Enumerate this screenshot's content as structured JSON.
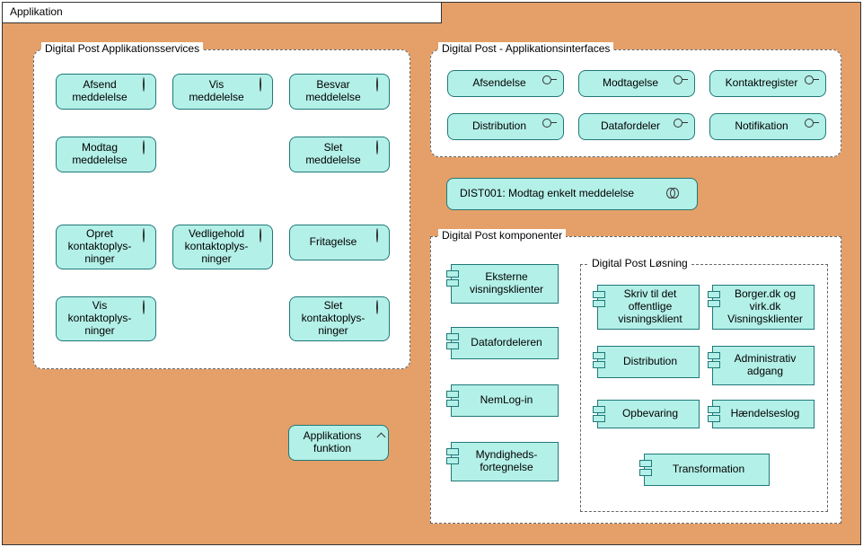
{
  "app": {
    "title": "Applikation"
  },
  "groups": {
    "services": {
      "label": "Digital Post Applikationsservices",
      "items": {
        "afsend": "Afsend meddelelse",
        "vis_med": "Vis meddelelse",
        "besvar": "Besvar meddelelse",
        "modtag": "Modtag meddelelse",
        "slet_med": "Slet meddelelse",
        "opret_kont": "Opret kontaktoplys-ninger",
        "vedl_kont": "Vedligehold kontaktoplys-ninger",
        "fritagelse": "Fritagelse",
        "vis_kont": "Vis kontaktoplys-ninger",
        "slet_kont": "Slet kontaktoplys-ninger"
      }
    },
    "interfaces": {
      "label": "Digital Post - Applikationsinterfaces",
      "items": {
        "afsendelse": "Afsendelse",
        "modtagelse": "Modtagelse",
        "kontaktreg": "Kontaktregister",
        "distribution": "Distribution",
        "datafordeler": "Datafordeler",
        "notifikation": "Notifikation"
      }
    },
    "dist001": {
      "label": "DIST001: Modtag enkelt meddelelse"
    },
    "komponenter": {
      "label": "Digital Post komponenter",
      "external": {
        "eksterne_visn": "Eksterne visningsklienter",
        "datafordeleren": "Datafordeleren",
        "nemlogin": "NemLog-in",
        "myndighed": "Myndigheds-fortegnelse"
      },
      "losning": {
        "label": "Digital Post Løsning",
        "items": {
          "skriv_off": "Skriv til det offentlige visningsklient",
          "borger_virk": "Borger.dk og virk.dk Visningsklienter",
          "distribution": "Distribution",
          "admin_adgang": "Administrativ adgang",
          "opbevaring": "Opbevaring",
          "haendelseslog": "Hændelseslog",
          "transformation": "Transformation"
        }
      }
    },
    "appfunk": {
      "label": "Applikations funktion"
    }
  }
}
